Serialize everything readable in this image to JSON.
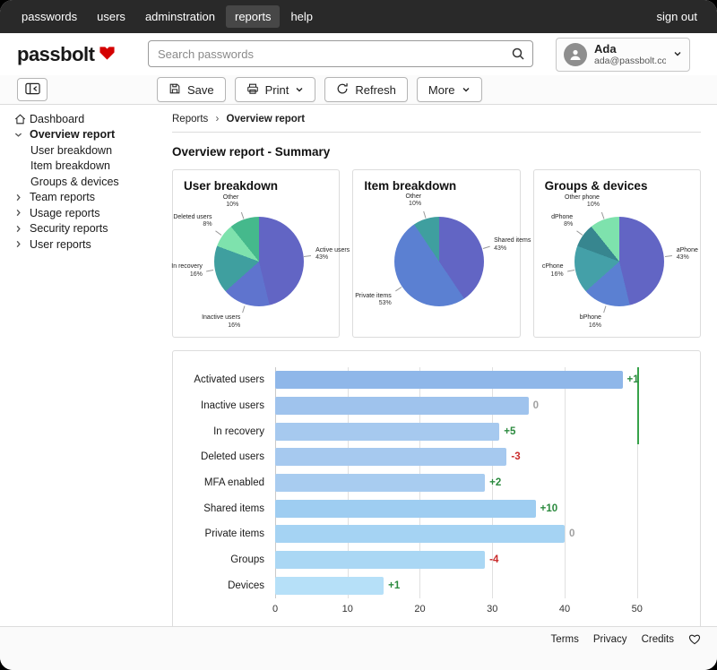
{
  "topnav": {
    "items": [
      "passwords",
      "users",
      "adminstration",
      "reports",
      "help"
    ],
    "active": "reports",
    "sign_out_label": "sign out"
  },
  "header": {
    "logo_text": "passbolt",
    "search_placeholder": "Search passwords",
    "user_name": "Ada",
    "user_email": "ada@passbolt.com"
  },
  "toolbar": {
    "save_label": "Save",
    "print_label": "Print",
    "refresh_label": "Refresh",
    "more_label": "More"
  },
  "sidebar": {
    "items": [
      {
        "label": "Dashboard",
        "icon": "home"
      },
      {
        "label": "Overview report",
        "expanded": true,
        "bold": true,
        "children": [
          "User breakdown",
          "Item breakdown",
          "Groups & devices"
        ]
      },
      {
        "label": "Team reports",
        "expanded": false
      },
      {
        "label": "Usage reports",
        "expanded": false
      },
      {
        "label": "Security reports",
        "expanded": false
      },
      {
        "label": "User reports",
        "expanded": false
      }
    ]
  },
  "breadcrumb": {
    "parts": [
      "Reports",
      "Overview report"
    ],
    "separator": "›"
  },
  "page_title": "Overview report - Summary",
  "colors": {
    "positive": "#2b8a3e",
    "negative": "#c92a2a",
    "neutral": "#a0a0a0",
    "accent_red": "#d40101"
  },
  "chart_data": [
    {
      "type": "pie",
      "title": "User breakdown",
      "slices": [
        {
          "label": "Active users",
          "pct": 43,
          "color": "#6265c4"
        },
        {
          "label": "Inactive users",
          "pct": 16,
          "color": "#5f74ce"
        },
        {
          "label": "In recovery",
          "pct": 16,
          "color": "#3f9f9f"
        },
        {
          "label": "Deleted users",
          "pct": 8,
          "color": "#7ee2ad"
        },
        {
          "label": "Other",
          "pct": 10,
          "color": "#45b98c"
        }
      ]
    },
    {
      "type": "pie",
      "title": "Item breakdown",
      "slices": [
        {
          "label": "Shared items",
          "pct": 43,
          "color": "#6265c4"
        },
        {
          "label": "Private items",
          "pct": 53,
          "color": "#5b80d2"
        },
        {
          "label": "Other",
          "pct": 10,
          "color": "#3f9f9f"
        }
      ]
    },
    {
      "type": "pie",
      "title": "Groups & devices",
      "slices": [
        {
          "label": "aPhone",
          "pct": 43,
          "color": "#6265c4"
        },
        {
          "label": "bPhone",
          "pct": 16,
          "color": "#5b80d2"
        },
        {
          "label": "cPhone",
          "pct": 16,
          "color": "#44a0a8"
        },
        {
          "label": "dPhone",
          "pct": 8,
          "color": "#37868f"
        },
        {
          "label": "Other phone",
          "pct": 10,
          "color": "#7ee2ad"
        }
      ]
    },
    {
      "type": "bar",
      "orientation": "horizontal",
      "categories": [
        "Activated users",
        "Inactive users",
        "In recovery",
        "Deleted users",
        "MFA enabled",
        "Shared items",
        "Private items",
        "Groups",
        "Devices"
      ],
      "values": [
        48,
        35,
        31,
        32,
        29,
        36,
        40,
        29,
        15
      ],
      "deltas": [
        "+1",
        "0",
        "+5",
        "-3",
        "+2",
        "+10",
        "0",
        "-4",
        "+1"
      ],
      "bar_colors": [
        "#8fb7e9",
        "#9fc3ed",
        "#a6c9ef",
        "#a6c9ef",
        "#a8ccf0",
        "#9ecdf1",
        "#a5d3f3",
        "#aad7f4",
        "#b6e0f8"
      ],
      "xticks": [
        0,
        10,
        20,
        30,
        40,
        50
      ],
      "xlim": [
        0,
        54
      ],
      "marker": {
        "value": 50,
        "color": "#37a24a",
        "span_rows": 3
      }
    }
  ],
  "footer": {
    "links": [
      "Terms",
      "Privacy",
      "Credits"
    ]
  }
}
